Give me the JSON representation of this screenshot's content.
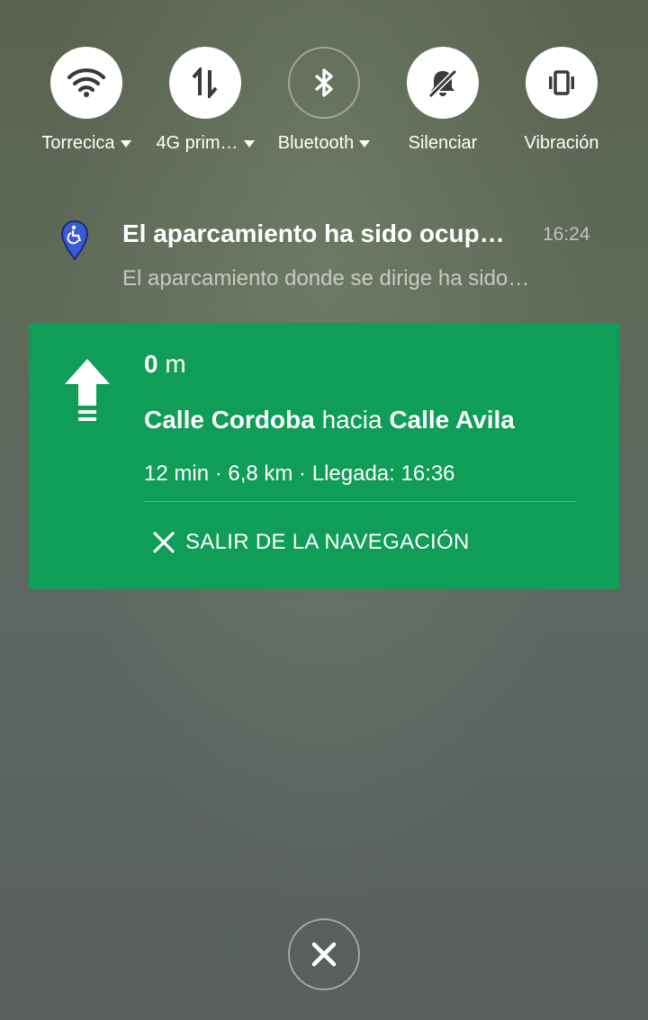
{
  "quick_settings": [
    {
      "label": "Torrecica",
      "icon": "wifi-icon",
      "active": true,
      "has_dropdown": true
    },
    {
      "label": "4G prim…",
      "icon": "mobile-data-icon",
      "active": true,
      "has_dropdown": true
    },
    {
      "label": "Bluetooth",
      "icon": "bluetooth-icon",
      "active": false,
      "has_dropdown": true
    },
    {
      "label": "Silenciar",
      "icon": "bell-off-icon",
      "active": true,
      "has_dropdown": false
    },
    {
      "label": "Vibración",
      "icon": "vibrate-icon",
      "active": true,
      "has_dropdown": false
    }
  ],
  "notification": {
    "icon": "accessible-parking-pin-icon",
    "title": "El aparcamiento ha sido ocup…",
    "time": "16:24",
    "body": "El aparcamiento donde se dirige ha sido…"
  },
  "navigation": {
    "distance_value": "0",
    "distance_unit": "m",
    "street_from": "Calle Cordoba",
    "connector": "hacia",
    "street_to": "Calle Avila",
    "eta": "12 min · 6,8 km · Llegada: 16:36",
    "exit_label": "SALIR DE LA NAVEGACIÓN",
    "card_color": "#0f9d58"
  },
  "dismiss_all": {
    "icon": "close-icon"
  }
}
